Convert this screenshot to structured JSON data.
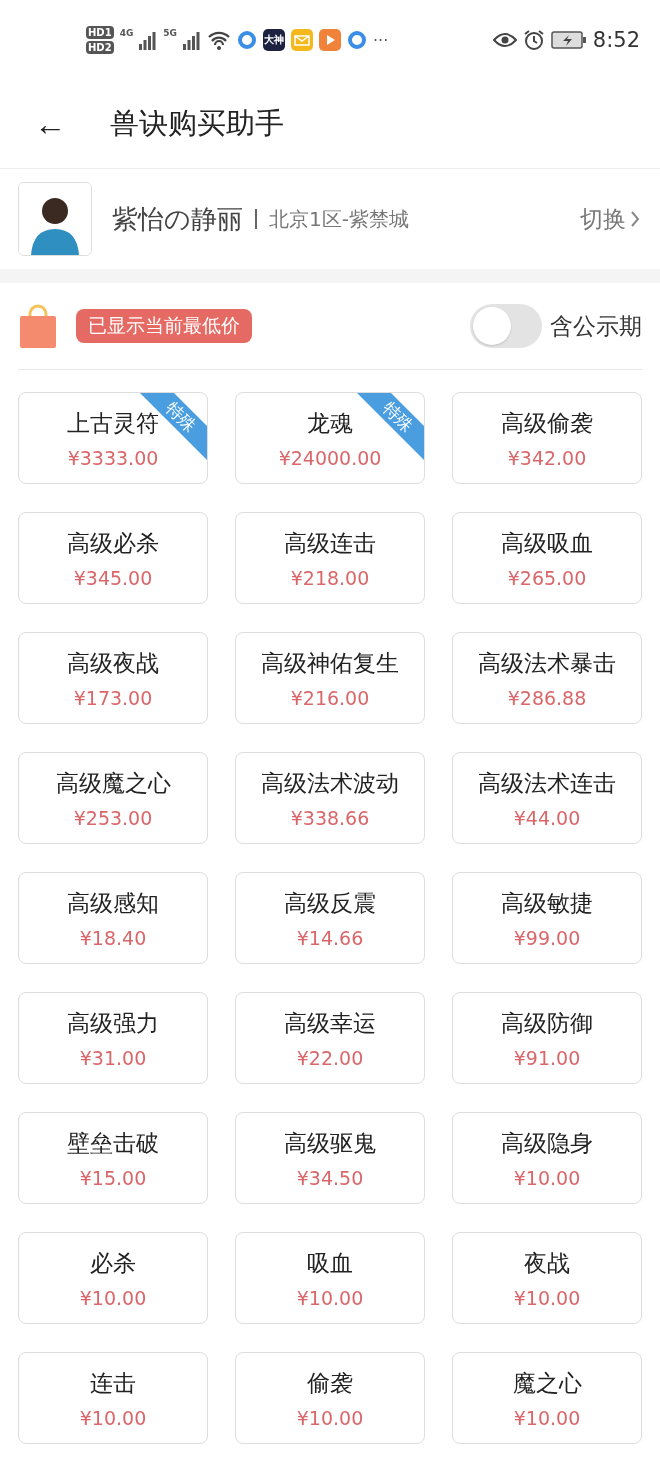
{
  "status_bar": {
    "sims": [
      {
        "label": "HD",
        "slot": "1"
      },
      {
        "label": "HD",
        "slot": "2"
      }
    ],
    "networks": [
      "4G",
      "5G"
    ],
    "app_badge": "大神",
    "more": "···",
    "time": "8:52"
  },
  "header": {
    "back": "←",
    "title": "兽诀购买助手"
  },
  "profile": {
    "name": "紫怡の静丽",
    "server": "北京1区-紫禁城",
    "switch_label": "切换"
  },
  "toolbar": {
    "notice": "已显示当前最低价",
    "toggle": {
      "label": "含公示期",
      "on": false
    }
  },
  "items": [
    {
      "name": "上古灵符",
      "price": "¥3333.00",
      "tag": "特殊"
    },
    {
      "name": "龙魂",
      "price": "¥24000.00",
      "tag": "特殊"
    },
    {
      "name": "高级偷袭",
      "price": "¥342.00"
    },
    {
      "name": "高级必杀",
      "price": "¥345.00"
    },
    {
      "name": "高级连击",
      "price": "¥218.00"
    },
    {
      "name": "高级吸血",
      "price": "¥265.00"
    },
    {
      "name": "高级夜战",
      "price": "¥173.00"
    },
    {
      "name": "高级神佑复生",
      "price": "¥216.00"
    },
    {
      "name": "高级法术暴击",
      "price": "¥286.88"
    },
    {
      "name": "高级魔之心",
      "price": "¥253.00"
    },
    {
      "name": "高级法术波动",
      "price": "¥338.66"
    },
    {
      "name": "高级法术连击",
      "price": "¥44.00"
    },
    {
      "name": "高级感知",
      "price": "¥18.40"
    },
    {
      "name": "高级反震",
      "price": "¥14.66"
    },
    {
      "name": "高级敏捷",
      "price": "¥99.00"
    },
    {
      "name": "高级强力",
      "price": "¥31.00"
    },
    {
      "name": "高级幸运",
      "price": "¥22.00"
    },
    {
      "name": "高级防御",
      "price": "¥91.00"
    },
    {
      "name": "壁垒击破",
      "price": "¥15.00"
    },
    {
      "name": "高级驱鬼",
      "price": "¥34.50"
    },
    {
      "name": "高级隐身",
      "price": "¥10.00"
    },
    {
      "name": "必杀",
      "price": "¥10.00"
    },
    {
      "name": "吸血",
      "price": "¥10.00"
    },
    {
      "name": "夜战",
      "price": "¥10.00"
    },
    {
      "name": "连击",
      "price": "¥10.00"
    },
    {
      "name": "偷袭",
      "price": "¥10.00"
    },
    {
      "name": "魔之心",
      "price": "¥10.00"
    }
  ]
}
